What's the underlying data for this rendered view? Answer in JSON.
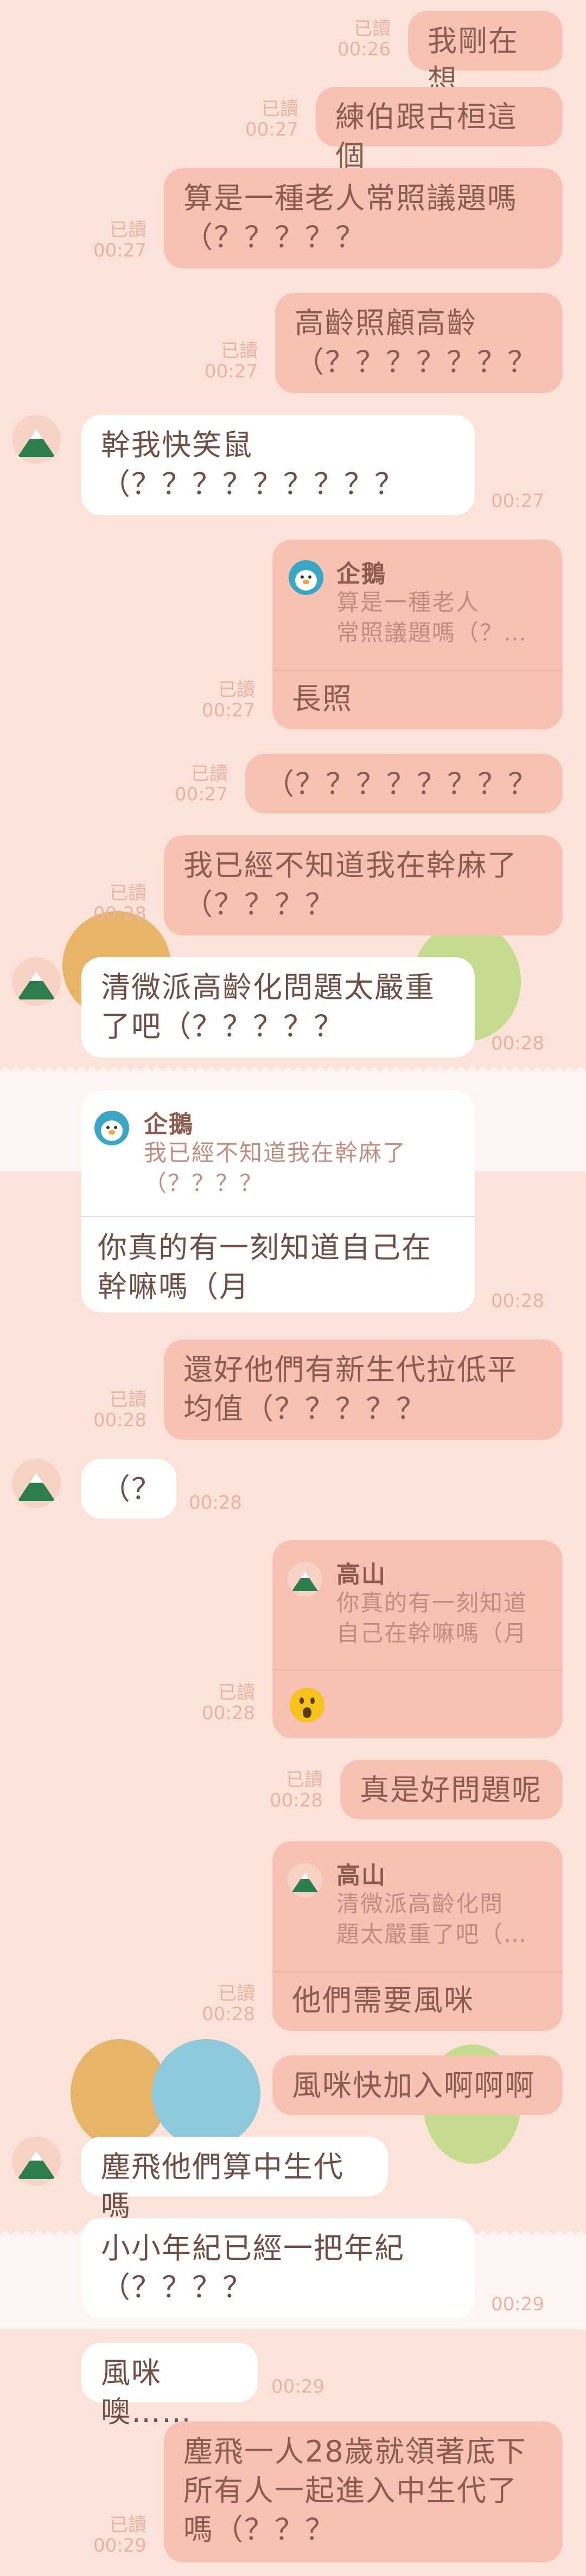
{
  "read_label": "已讀",
  "messages": {
    "m1": {
      "text": "我剛在想",
      "time": "00:26"
    },
    "m2": {
      "text": "練伯跟古桓這個",
      "time": "00:27"
    },
    "m3": {
      "text": "算是一種老人常照議題嗎\n（？？？？？",
      "time": "00:27"
    },
    "m4": {
      "text": "高齡照顧高齡\n（？？？？？？？",
      "time": "00:27"
    },
    "m5": {
      "text": "幹我快笑鼠\n（？？？？？？？？？",
      "time": "00:27"
    },
    "m6": {
      "quote_name": "企鵝",
      "quote_text": "算是一種老人\n常照議題嗎（？…",
      "text": "長照",
      "time": "00:27"
    },
    "m7": {
      "text": "（？？？？？？？？",
      "time": "00:27"
    },
    "m8": {
      "text": "我已經不知道我在幹麻了\n（？？？？",
      "time": "00:28"
    },
    "m9": {
      "text": "清微派高齡化問題太嚴重\n了吧（？？？？？",
      "time": "00:28"
    },
    "m10": {
      "quote_name": "企鵝",
      "quote_text": "我已經不知道我在幹麻了\n（？？？？",
      "text": "你真的有一刻知道自己在\n幹嘛嗎（月",
      "time": "00:28"
    },
    "m11": {
      "text": "還好他們有新生代拉低平\n均值（？？？？？",
      "time": "00:28"
    },
    "m12": {
      "text": "（？",
      "time": "00:28"
    },
    "m13": {
      "quote_name": "高山",
      "quote_text": "你真的有一刻知道\n自己在幹嘛嗎（月",
      "time": "00:28"
    },
    "m14": {
      "text": "真是好問題呢",
      "time": "00:28"
    },
    "m15": {
      "quote_name": "高山",
      "quote_text": "清微派高齡化問\n題太嚴重了吧（…",
      "text": "他們需要風咪",
      "time": "00:28"
    },
    "m16": {
      "text": "風咪快加入啊啊啊"
    },
    "m17": {
      "text": "塵飛他們算中生代嗎"
    },
    "m18": {
      "text": "小小年紀已經一把年紀\n（？？？？",
      "time": "00:29"
    },
    "m19": {
      "text": "風咪噢……",
      "time": "00:29"
    },
    "m20": {
      "text": "塵飛一人28歲就領著底下\n所有人一起進入中生代了\n嗎（？？？",
      "time": "00:29"
    }
  },
  "colors": {
    "background": "#fce3da",
    "outgoing": "#f7c1b3",
    "incoming": "#ffffff",
    "meta": "#e9b2a4"
  },
  "icons": [
    "mountain-avatar-icon",
    "penguin-avatar-icon",
    "surprised-emoji-icon"
  ]
}
